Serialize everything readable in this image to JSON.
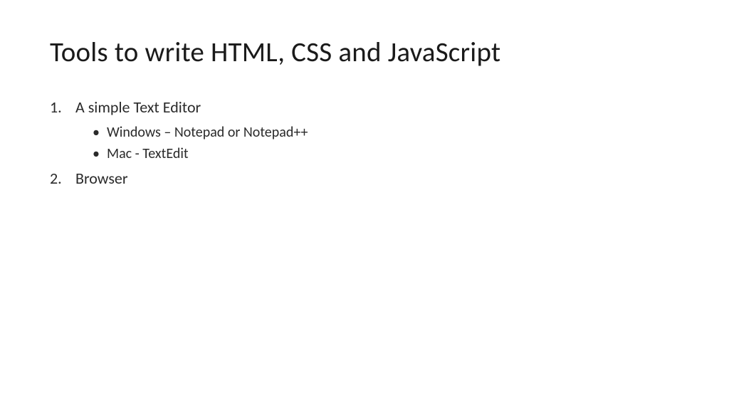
{
  "title": "Tools to write HTML, CSS and JavaScript",
  "items": [
    {
      "label": "A simple Text Editor",
      "sub": [
        "Windows – Notepad or Notepad++",
        "Mac - TextEdit"
      ]
    },
    {
      "label": "Browser",
      "sub": []
    }
  ]
}
